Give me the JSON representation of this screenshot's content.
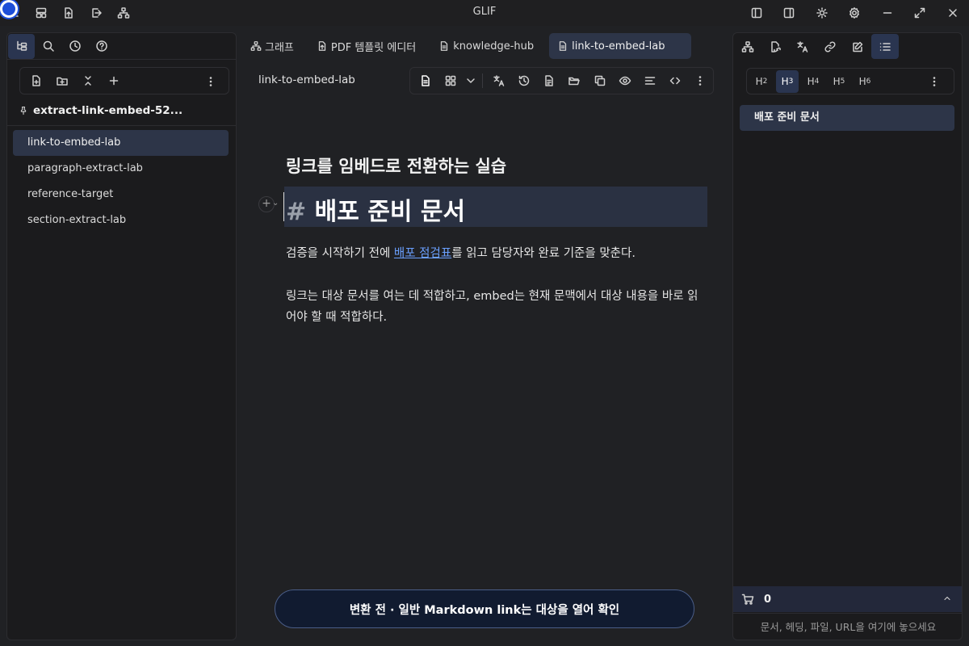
{
  "app": {
    "title": "GLIF"
  },
  "left_panel": {
    "project_name": "extract-link-embed-52...",
    "files": [
      "link-to-embed-lab",
      "paragraph-extract-lab",
      "reference-target",
      "section-extract-lab"
    ]
  },
  "editor_tabs": [
    "그래프",
    "PDF 템플릿 에디터",
    "knowledge-hub",
    "link-to-embed-lab"
  ],
  "document": {
    "name": "link-to-embed-lab",
    "subtitle": "링크를 임베드로 전환하는 실습",
    "h1_hash": "#",
    "h1_text": "배포 준비 문서",
    "para1_before": "검증을 시작하기 전에 ",
    "para1_link": "배포 점검표",
    "para1_after": "를 읽고 담당자와 완료 기준을 맞춘다.",
    "para2": "링크는 대상 문서를 여는 데 적합하고, embed는 현재 문맥에서 대상 내용을 바로 읽어야 할 때 적합하다."
  },
  "banner": {
    "text": "변환 전 · 일반 Markdown link는 대상을 열어 확인"
  },
  "right_panel": {
    "headings": [
      {
        "letter": "H",
        "level": "2"
      },
      {
        "letter": "H",
        "level": "3"
      },
      {
        "letter": "H",
        "level": "4"
      },
      {
        "letter": "H",
        "level": "5"
      },
      {
        "letter": "H",
        "level": "6"
      }
    ],
    "outline": [
      "배포 준비 문서"
    ],
    "cart_count": "0",
    "drop_hint": "문서, 헤딩, 파일, URL을 여기에 놓으세요"
  },
  "colors": {
    "accent": "#2d3548",
    "link": "#6aa0ff",
    "banner_border": "#4a5d87"
  }
}
